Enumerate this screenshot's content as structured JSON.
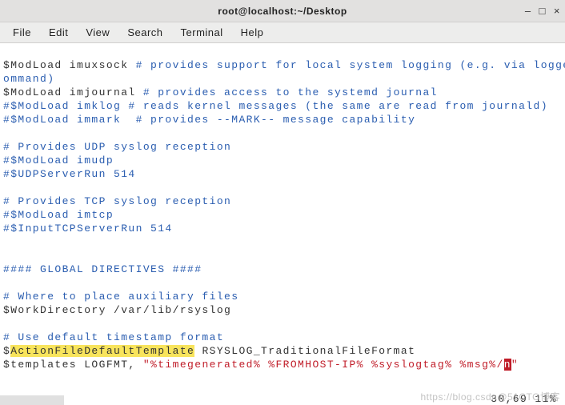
{
  "window": {
    "title": "root@localhost:~/Desktop",
    "btn_min": "–",
    "btn_max": "□",
    "btn_close": "×"
  },
  "menu": {
    "file": "File",
    "edit": "Edit",
    "view": "View",
    "search": "Search",
    "terminal": "Terminal",
    "help": "Help"
  },
  "lines": {
    "l1a": "$ModLoad imuxsock ",
    "l1b": "# provides support for local system logging (e.g. via logger",
    "l2a": "ommand)",
    "l3a": "$ModLoad imjournal ",
    "l3b": "# provides access to the systemd journal",
    "l4": "#$ModLoad imklog # reads kernel messages (the same are read from journald)",
    "l5": "#$ModLoad immark  # provides --MARK-- message capability",
    "l6": "",
    "l7": "# Provides UDP syslog reception",
    "l8": "#$ModLoad imudp",
    "l9": "#$UDPServerRun 514",
    "l10": "",
    "l11": "# Provides TCP syslog reception",
    "l12": "#$ModLoad imtcp",
    "l13": "#$InputTCPServerRun 514",
    "l14": "",
    "l15": "",
    "l16": "#### GLOBAL DIRECTIVES ####",
    "l17": "",
    "l18": "# Where to place auxiliary files",
    "l19": "$WorkDirectory /var/lib/rsyslog",
    "l20": "",
    "l21": "# Use default timestamp format",
    "l22a": "$",
    "l22b": "ActionFileDefaultTemplate",
    "l22c": " RSYSLOG_TraditionalFileFormat",
    "l23a": "$templates LOGFMT, ",
    "l23b": "\"%timegenerated% %FROMHOST-IP% %syslogtag% %msg%/",
    "l23c": "n",
    "l23d": "\""
  },
  "status": {
    "pos": "30,69         11%"
  },
  "watermark": "https://blog.csdn@51CTO博客"
}
